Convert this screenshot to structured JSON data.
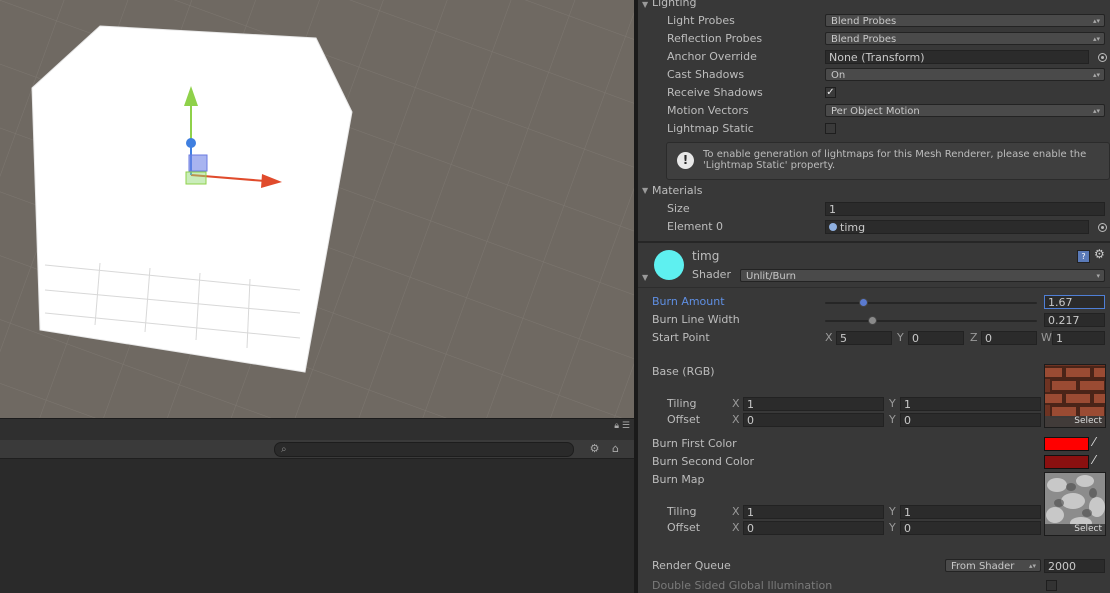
{
  "lighting": {
    "header": "Lighting",
    "light_probes": {
      "label": "Light Probes",
      "value": "Blend Probes"
    },
    "reflection_probes": {
      "label": "Reflection Probes",
      "value": "Blend Probes"
    },
    "anchor_override": {
      "label": "Anchor Override",
      "value": "None (Transform)"
    },
    "cast_shadows": {
      "label": "Cast Shadows",
      "value": "On"
    },
    "receive_shadows": {
      "label": "Receive Shadows",
      "checked": true
    },
    "motion_vectors": {
      "label": "Motion Vectors",
      "value": "Per Object Motion"
    },
    "lightmap_static": {
      "label": "Lightmap Static",
      "checked": false
    },
    "help_text": "To enable generation of lightmaps for this Mesh Renderer, please enable the 'Lightmap Static' property."
  },
  "materials": {
    "header": "Materials",
    "size": {
      "label": "Size",
      "value": "1"
    },
    "element0": {
      "label": "Element 0",
      "value": "timg"
    }
  },
  "material": {
    "name": "timg",
    "shader_label": "Shader",
    "shader_value": "Unlit/Burn",
    "burn_amount": {
      "label": "Burn Amount",
      "value": "1.67",
      "slider": 0.18
    },
    "burn_line_width": {
      "label": "Burn Line Width",
      "value": "0.217",
      "slider": 0.22
    },
    "start_point": {
      "label": "Start Point",
      "x_label": "X",
      "x": "5",
      "y_label": "Y",
      "y": "0",
      "z_label": "Z",
      "z": "0",
      "w_label": "W",
      "w": "1"
    },
    "base": {
      "label": "Base (RGB)",
      "tiling_label": "Tiling",
      "offset_label": "Offset",
      "tiling_x": "1",
      "tiling_y": "1",
      "offset_x": "0",
      "offset_y": "0",
      "select": "Select"
    },
    "burn_first_color": {
      "label": "Burn First Color",
      "color": "#ff0000"
    },
    "burn_second_color": {
      "label": "Burn Second Color",
      "color": "#8b1010"
    },
    "burn_map": {
      "label": "Burn Map",
      "tiling_label": "Tiling",
      "offset_label": "Offset",
      "tiling_x": "1",
      "tiling_y": "1",
      "offset_x": "0",
      "offset_y": "0",
      "select": "Select"
    },
    "render_queue": {
      "label": "Render Queue",
      "dropdown": "From Shader",
      "value": "2000"
    },
    "double_sided": {
      "label": "Double Sided Global Illumination"
    },
    "axis_x": "X",
    "axis_y": "Y"
  },
  "colors": {
    "accent_blue": "#4f7fd6",
    "material_ball": "#5ef0f0"
  }
}
